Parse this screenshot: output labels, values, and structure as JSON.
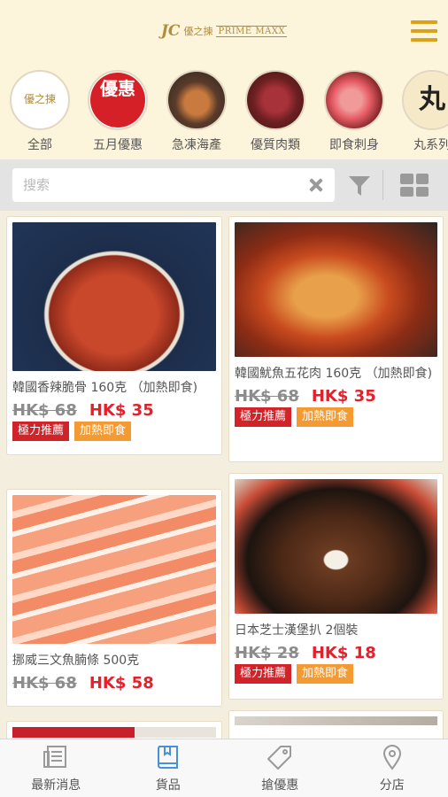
{
  "header": {
    "logo_mark": "JC",
    "logo_cn": "優之揀",
    "logo_en": "PRIME MAXX",
    "menu_icon": "hamburger-menu-icon"
  },
  "categories": [
    {
      "label": "全部",
      "inner": "優之揀"
    },
    {
      "label": "五月優惠",
      "inner": "優惠"
    },
    {
      "label": "急凍海產"
    },
    {
      "label": "優質肉類"
    },
    {
      "label": "即食刺身"
    },
    {
      "label": "丸系列",
      "inner": "丸"
    }
  ],
  "search": {
    "placeholder": "搜索",
    "value": "",
    "clear_icon": "clear-icon",
    "filter_icon": "filter-icon",
    "grid_icon": "grid-view-icon"
  },
  "products": [
    {
      "name": "韓國香辣脆骨 160克 （加熱即食)",
      "old_price": "HK$ 68",
      "new_price": "HK$ 35",
      "tags": [
        "極力推薦",
        "加熱即食"
      ]
    },
    {
      "name": "韓國魷魚五花肉 160克 （加熱即食)",
      "old_price": "HK$ 68",
      "new_price": "HK$ 35",
      "tags": [
        "極力推薦",
        "加熱即食"
      ]
    },
    {
      "name": "挪威三文魚腩條 500克",
      "old_price": "HK$ 68",
      "new_price": "HK$ 58",
      "tags": []
    },
    {
      "name": "日本芝士漢堡扒 2個裝",
      "old_price": "HK$ 28",
      "new_price": "HK$ 18",
      "tags": [
        "極力推薦",
        "加熱即食"
      ]
    }
  ],
  "bottom_nav": [
    {
      "label": "最新消息",
      "icon": "news-icon"
    },
    {
      "label": "貨品",
      "icon": "book-icon",
      "active": true
    },
    {
      "label": "搶優惠",
      "icon": "tag-icon"
    },
    {
      "label": "分店",
      "icon": "location-pin-icon"
    }
  ],
  "colors": {
    "brand_gold": "#b08d3c",
    "menu_yellow": "#d9a21a",
    "price_red": "#e5202a",
    "tag_red": "#d0232a",
    "tag_orange": "#f39b32",
    "nav_active": "#4a8fd9"
  }
}
